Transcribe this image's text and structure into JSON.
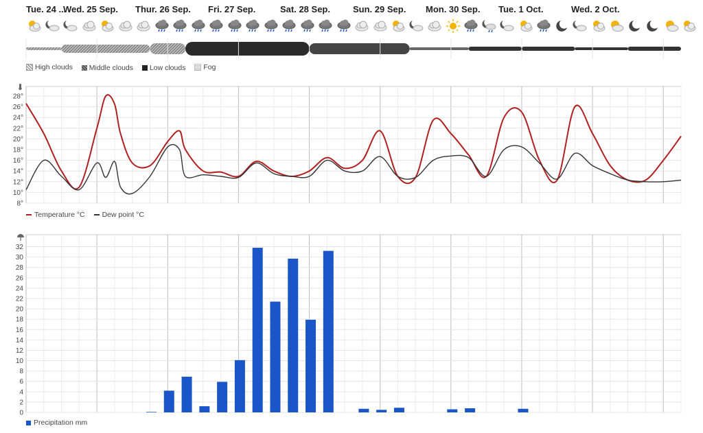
{
  "days": [
    "Tue. 24 ...",
    "Wed. 25 Sep.",
    "Thur. 26 Sep.",
    "Fri. 27 Sep.",
    "Sat. 28 Sep.",
    "Sun. 29 Sep.",
    "Mon. 30 Sep.",
    "Tue. 1 Oct.",
    "Wed. 2 Oct."
  ],
  "icons": [
    "partly-cloudy-day-icon",
    "moon-cloud-icon",
    "moon-cloud-icon",
    "cloud-icon",
    "partly-cloudy-day-icon",
    "cloud-icon",
    "cloud-icon",
    "rain-cloud-icon",
    "rain-cloud-icon",
    "rain-cloud-icon",
    "rain-cloud-icon",
    "rain-cloud-icon",
    "rain-cloud-icon",
    "rain-cloud-icon",
    "rain-cloud-icon",
    "rain-cloud-icon",
    "rain-cloud-icon",
    "rain-cloud-icon",
    "cloud-icon",
    "cloud-icon",
    "partly-cloudy-day-icon",
    "moon-cloud-icon",
    "cloud-icon",
    "sun-icon",
    "rain-cloud-icon",
    "rain-moon-icon",
    "moon-cloud-icon",
    "partly-cloudy-day-icon",
    "rain-cloud-icon",
    "moon-icon",
    "moon-cloud-icon",
    "partly-cloudy-day-icon",
    "sun-cloud-icon",
    "moon-icon",
    "moon-icon",
    "sun-cloud-icon",
    "partly-cloudy-day-icon"
  ],
  "clouds": {
    "legend": [
      "High clouds",
      "Middle clouds",
      "Low clouds",
      "Fog"
    ],
    "colors": {
      "high": "#9a9a9a",
      "middle": "#6a6a6a",
      "low": "#222222",
      "fog": "#bbbbbb"
    }
  },
  "chart_data": [
    {
      "type": "line",
      "ylim": [
        8,
        28
      ],
      "yticks": [
        "8°",
        "10°",
        "12°",
        "14°",
        "16°",
        "18°",
        "20°",
        "22°",
        "24°",
        "26°",
        "28°"
      ],
      "axis_icon": "thermometer-icon",
      "x_hours": [
        0,
        6,
        12,
        18,
        24,
        27,
        30,
        32,
        36,
        42,
        48,
        52,
        54,
        60,
        66,
        72,
        78,
        84,
        90,
        96,
        102,
        108,
        114,
        120,
        126,
        132,
        138,
        144,
        150,
        156,
        162,
        168,
        174,
        180,
        186,
        192,
        198,
        204,
        210,
        216,
        222
      ],
      "series": [
        {
          "name": "Temperature °C",
          "color": "#b02020",
          "values": [
            26.6,
            21,
            14,
            11,
            22,
            28,
            26.5,
            21,
            15.5,
            15,
            19.5,
            21.5,
            18,
            14,
            13.8,
            13,
            15.8,
            14,
            13,
            14,
            16.5,
            14.5,
            16,
            21.5,
            13,
            12.8,
            23.5,
            21,
            17,
            13,
            24,
            25,
            16,
            12.3,
            26,
            21,
            15,
            12.3,
            12.3,
            16,
            20.5
          ]
        },
        {
          "name": "Dew point °C",
          "color": "#333333",
          "values": [
            10.5,
            16,
            13,
            10.5,
            15.5,
            12.8,
            15.8,
            11,
            9.8,
            13,
            18.5,
            18,
            13,
            13.3,
            13,
            12.8,
            15.5,
            13.5,
            13,
            13,
            16,
            14,
            14,
            16.7,
            13,
            12.8,
            16,
            16.8,
            16.5,
            13,
            18,
            18.5,
            15.5,
            12.5,
            17.3,
            15,
            13.5,
            12.3,
            12,
            12,
            12.3
          ]
        }
      ]
    },
    {
      "type": "bar",
      "ylim": [
        0,
        33
      ],
      "yticks": [
        "0",
        "2",
        "4",
        "6",
        "8",
        "10",
        "12",
        "14",
        "16",
        "18",
        "20",
        "22",
        "24",
        "26",
        "28",
        "30",
        "32"
      ],
      "axis_icon": "umbrella-icon",
      "x_hours": [
        42,
        48,
        54,
        60,
        66,
        72,
        78,
        84,
        90,
        96,
        102,
        114,
        120,
        126,
        144,
        150,
        168
      ],
      "series": [
        {
          "name": "Precipitation mm",
          "color": "#1a56c8",
          "values": [
            0.1,
            4.2,
            6.9,
            1.2,
            5.9,
            10.1,
            31.8,
            21.4,
            29.7,
            17.9,
            31.2,
            0.7,
            0.5,
            0.9,
            0.6,
            0.8,
            0.7
          ]
        }
      ]
    }
  ]
}
